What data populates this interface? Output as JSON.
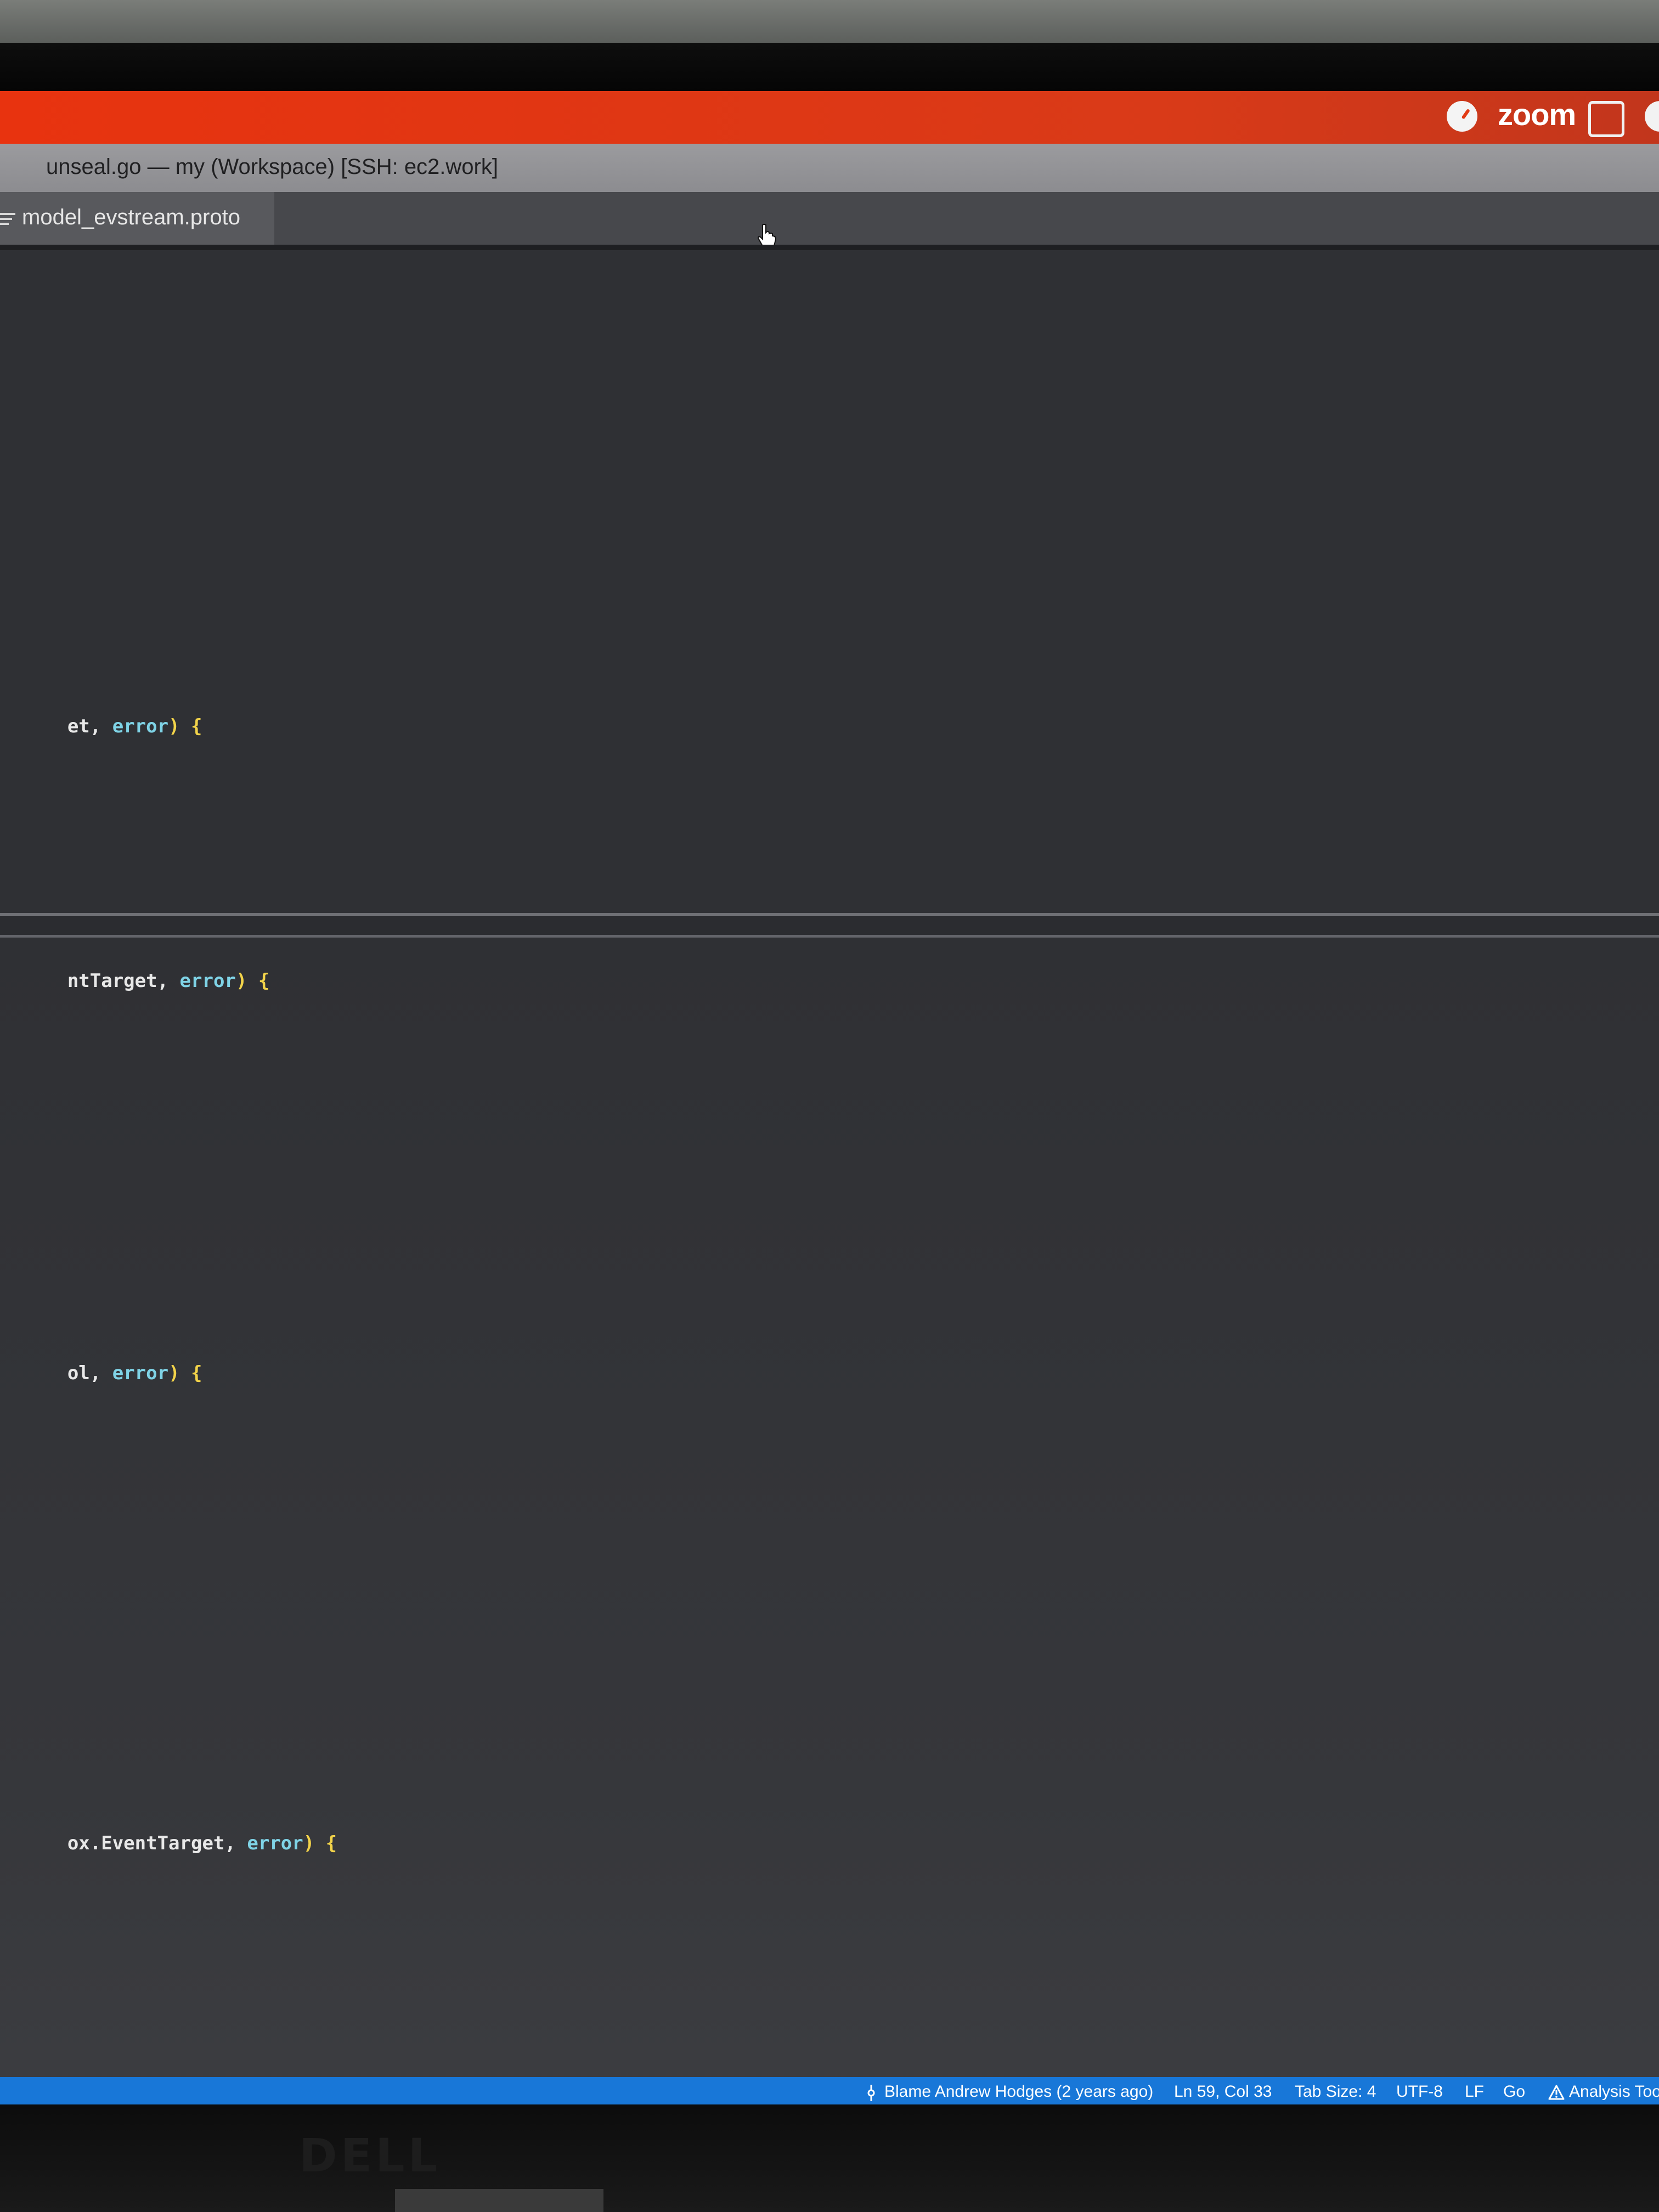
{
  "zoom_menubar": {
    "app_label": "zoom",
    "accent": "#e8330f"
  },
  "window": {
    "title": "unseal.go — my (Workspace) [SSH: ec2.work]"
  },
  "tabs": [
    {
      "label": "model_evstream.proto"
    }
  ],
  "editor": {
    "top_pane_lines": [
      {
        "ident": "et",
        "sep": ", ",
        "type": "error",
        "close": ")",
        "brace": " {"
      }
    ],
    "bottom_pane_lines": [
      {
        "ident": "ntTarget",
        "sep": ", ",
        "type": "error",
        "close": ")",
        "brace": " {"
      },
      {
        "ident": "ol",
        "sep": ", ",
        "type": "error",
        "close": ")",
        "brace": " {"
      },
      {
        "ident": "ox.EventTarget",
        "sep": ", ",
        "type": "error",
        "close": ")",
        "brace": " {"
      }
    ]
  },
  "statusbar": {
    "blame": "Blame Andrew Hodges (2 years ago)",
    "cursor_position": "Ln 59, Col 33",
    "tab_size": "Tab Size: 4",
    "encoding": "UTF-8",
    "line_ending": "LF",
    "language": "Go",
    "analysis": "Analysis Too",
    "color": "#1877d8"
  },
  "monitor": {
    "brand": "DELL"
  }
}
